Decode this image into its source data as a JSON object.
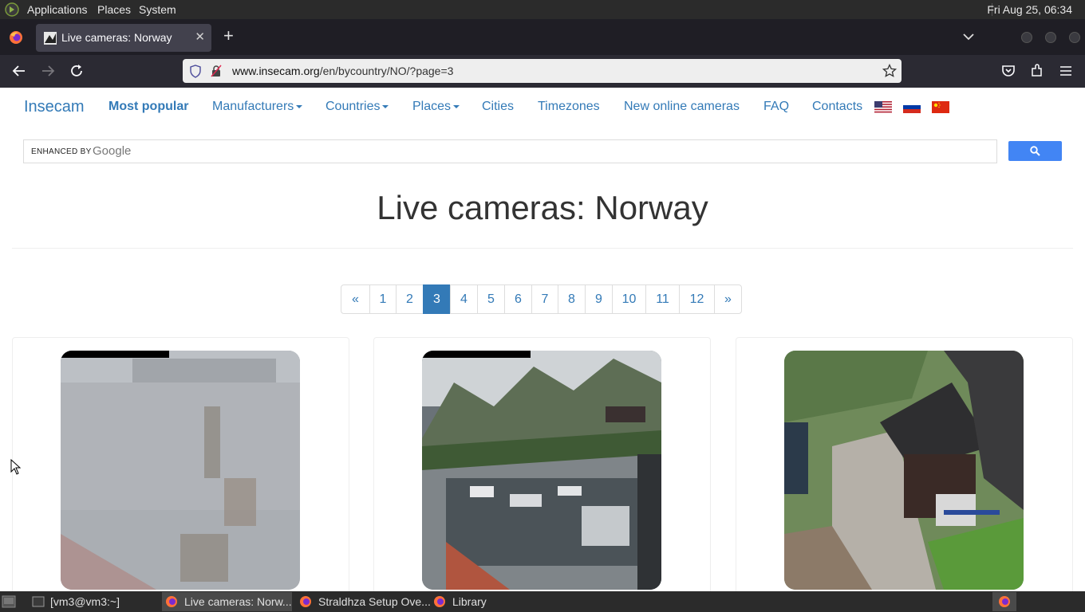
{
  "panel": {
    "applications": "Applications",
    "places": "Places",
    "system": "System",
    "clock": "Fri Aug 25, 06:34"
  },
  "browser": {
    "tab_title": "Live cameras: Norway",
    "url_domain": "www.insecam.org",
    "url_path": "/en/bycountry/NO/?page=3"
  },
  "site": {
    "brand": "Insecam",
    "nav": {
      "most_popular": "Most popular",
      "manufacturers": "Manufacturers",
      "countries": "Countries",
      "places": "Places",
      "cities": "Cities",
      "timezones": "Timezones",
      "new_online": "New online cameras",
      "faq": "FAQ",
      "contacts": "Contacts"
    },
    "search": {
      "enhanced_by": "ENHANCED BY",
      "google": "Google"
    },
    "heading": "Live cameras: Norway",
    "pagination": {
      "prev": "«",
      "pages": [
        "1",
        "2",
        "3",
        "4",
        "5",
        "6",
        "7",
        "8",
        "9",
        "10",
        "11",
        "12"
      ],
      "current": "3",
      "next": "»"
    }
  },
  "taskbar": {
    "terminal": "[vm3@vm3:~]",
    "firefox_active": "Live cameras: Norw...",
    "straldhza": "Straldhza Setup Ove...",
    "library": "Library"
  },
  "colors": {
    "link": "#337ab7",
    "search_button": "#4285f4",
    "panel": "#2b2b2b"
  }
}
